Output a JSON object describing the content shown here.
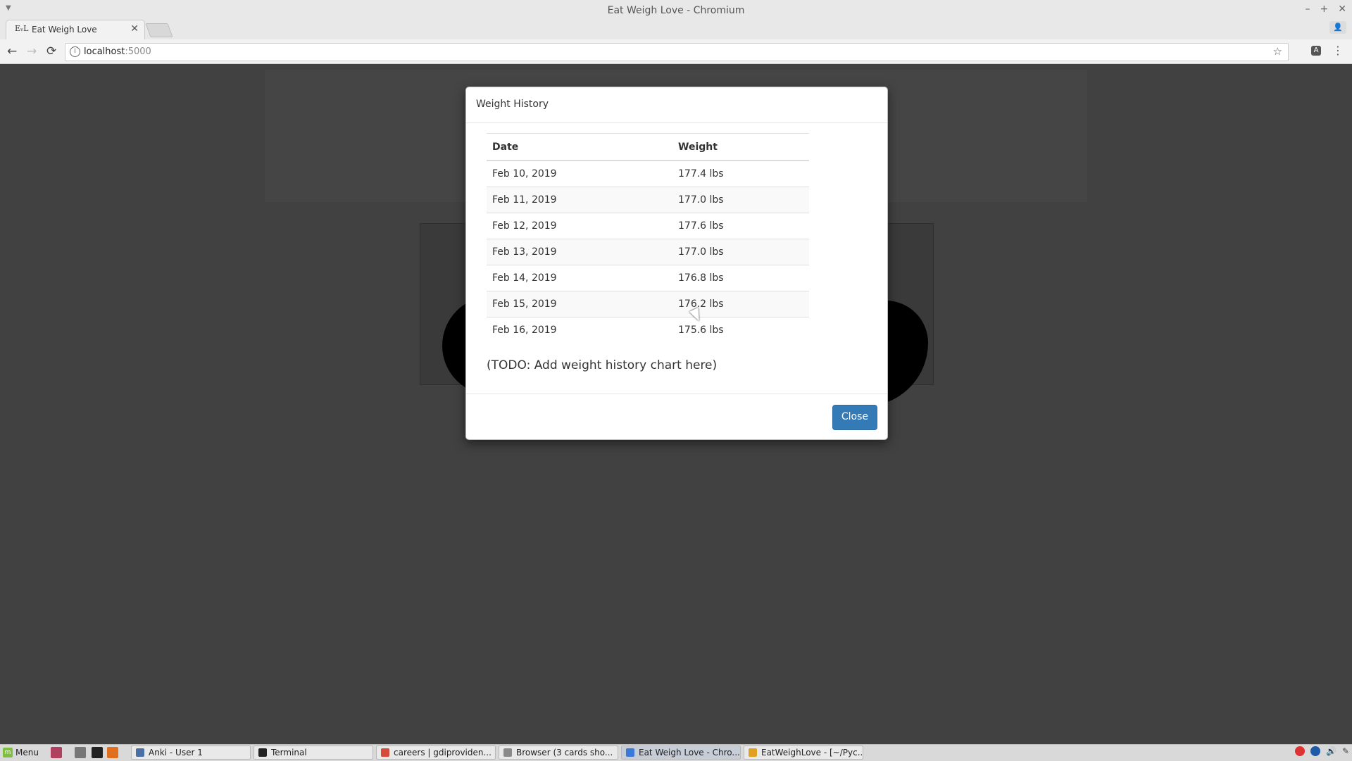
{
  "window": {
    "title": "Eat Weigh Love - Chromium"
  },
  "tab": {
    "favicon": "EᵥL",
    "title": "Eat Weigh Love"
  },
  "address_bar": {
    "host": "localhost",
    "port": ":5000"
  },
  "modal": {
    "title": "Weight History",
    "headers": {
      "date": "Date",
      "weight": "Weight"
    },
    "rows": [
      {
        "date": "Feb 10, 2019",
        "weight": "177.4 lbs"
      },
      {
        "date": "Feb 11, 2019",
        "weight": "177.0 lbs"
      },
      {
        "date": "Feb 12, 2019",
        "weight": "177.6 lbs"
      },
      {
        "date": "Feb 13, 2019",
        "weight": "177.0 lbs"
      },
      {
        "date": "Feb 14, 2019",
        "weight": "176.8 lbs"
      },
      {
        "date": "Feb 15, 2019",
        "weight": "176.2 lbs"
      },
      {
        "date": "Feb 16, 2019",
        "weight": "175.6 lbs"
      }
    ],
    "todo_note": "(TODO: Add weight history chart here)",
    "close_label": "Close"
  },
  "taskbar": {
    "menu_label": "Menu",
    "tasks": [
      {
        "label": "Anki - User 1",
        "icon_color": "#4a6fa5"
      },
      {
        "label": "Terminal",
        "icon_color": "#222222"
      },
      {
        "label": "careers | gdiproviden...",
        "icon_color": "#d64b3a"
      },
      {
        "label": "Browser (3 cards sho...",
        "icon_color": "#8a8a8a"
      },
      {
        "label": "Eat Weigh Love - Chro...",
        "icon_color": "#3b78d8"
      },
      {
        "label": "EatWeighLove - [~/Pyc...",
        "icon_color": "#e0a020"
      }
    ]
  },
  "colors": {
    "primary_button": "#337ab7",
    "backdrop": "#414141"
  }
}
